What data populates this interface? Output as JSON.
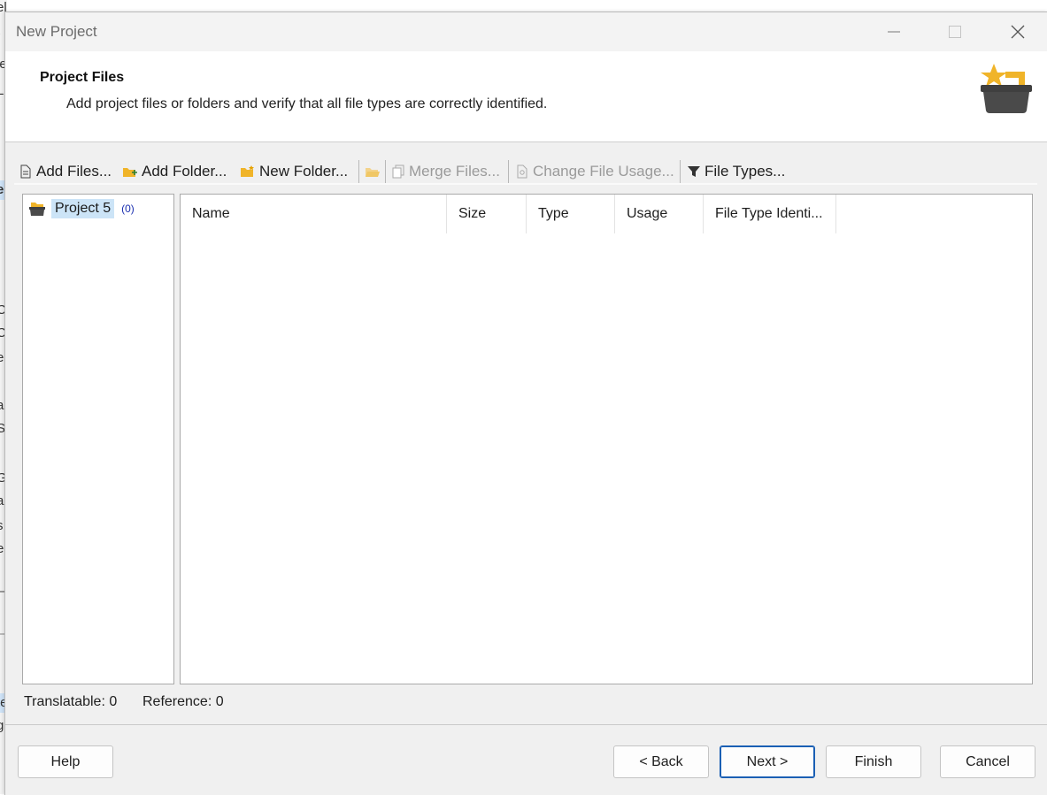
{
  "background_app": {
    "fragments": [
      "elp",
      "/",
      "ie",
      "Le",
      "er",
      "C",
      "C",
      "er",
      "ab",
      "S",
      "G",
      "ab",
      "s",
      "e",
      "te",
      "g"
    ]
  },
  "window": {
    "title": "New Project",
    "controls": [
      "minimize-icon",
      "maximize-icon",
      "close-icon"
    ]
  },
  "header": {
    "title": "Project Files",
    "description": "Add project files or folders and verify that all file types are correctly identified.",
    "icon": "project-basket-star-icon",
    "icon_colors": {
      "star": "#f0b429",
      "basket": "#454545"
    }
  },
  "toolbar": {
    "add_files": "Add Files...",
    "add_folder": "Add Folder...",
    "new_folder": "New Folder...",
    "merge_files": "Merge Files...",
    "change_file_usage": "Change File Usage...",
    "file_types": "File Types..."
  },
  "tree": {
    "project_name": "Project 5",
    "project_count": "(0)"
  },
  "file_list": {
    "columns": [
      "Name",
      "Size",
      "Type",
      "Usage",
      "File Type Identi..."
    ],
    "rows": []
  },
  "counts": {
    "translatable": "Translatable: 0",
    "reference": "Reference: 0"
  },
  "buttons": {
    "help": "Help",
    "back": "< Back",
    "next": "Next >",
    "finish": "Finish",
    "cancel": "Cancel"
  },
  "colors": {
    "accent": "#1a5fb4",
    "selection": "#cce4f7",
    "count_text": "#1a2fb0",
    "folder": "#f0b429"
  }
}
